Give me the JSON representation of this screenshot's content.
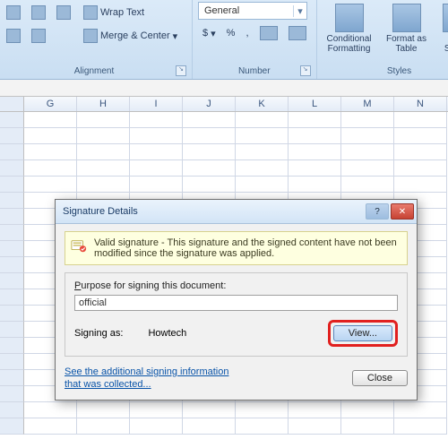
{
  "ribbon": {
    "alignment": {
      "title": "Alignment",
      "wrap_label": "Wrap Text",
      "merge_label": "Merge & Center"
    },
    "number": {
      "title": "Number",
      "format": "General",
      "currency": "$",
      "percent": "%",
      "comma": ","
    },
    "styles": {
      "title": "Styles",
      "conditional": "Conditional Formatting",
      "table": "Format as Table",
      "cell": "Cell Styles"
    }
  },
  "columns": [
    "G",
    "H",
    "I",
    "J",
    "K",
    "L",
    "M",
    "N"
  ],
  "dialog": {
    "title": "Signature Details",
    "info": "Valid signature - This signature and the signed content have not been modified since the signature was applied.",
    "purpose_label_pre": "P",
    "purpose_label_rest": "urpose for signing this document:",
    "purpose_value": "official",
    "signing_label": "Signing as:",
    "signer_name": "Howtech",
    "view_btn": "View...",
    "link_line1": "See the additional signing information",
    "link_line2": "that was collected...",
    "close_btn": "Close"
  }
}
